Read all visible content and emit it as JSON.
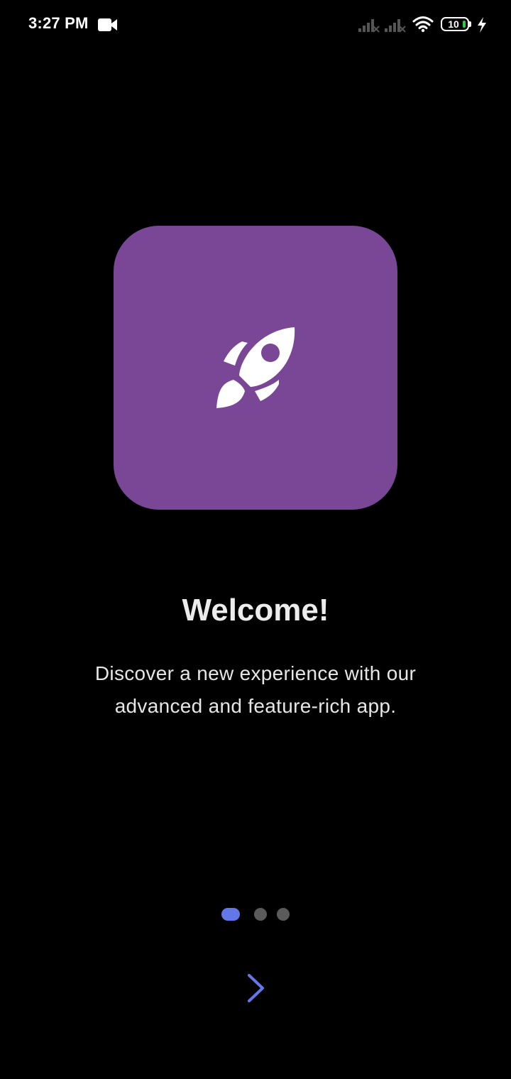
{
  "status_bar": {
    "time": "3:27 PM",
    "battery_level": "10",
    "icons": [
      "video-camera-icon",
      "signal-icon",
      "signal-icon",
      "wifi-icon",
      "battery-icon",
      "charging-icon"
    ]
  },
  "onboarding": {
    "hero_icon": "rocket-icon",
    "title": "Welcome!",
    "description": "Discover a new experience with our advanced and feature-rich app.",
    "page_count": 3,
    "current_page": 1
  },
  "navigation": {
    "next_icon": "chevron-right-icon"
  },
  "colors": {
    "background": "#000000",
    "hero_card": "#7a4797",
    "accent": "#6377e8",
    "dot_inactive": "#5b5b5b",
    "title_text": "#ececec"
  }
}
